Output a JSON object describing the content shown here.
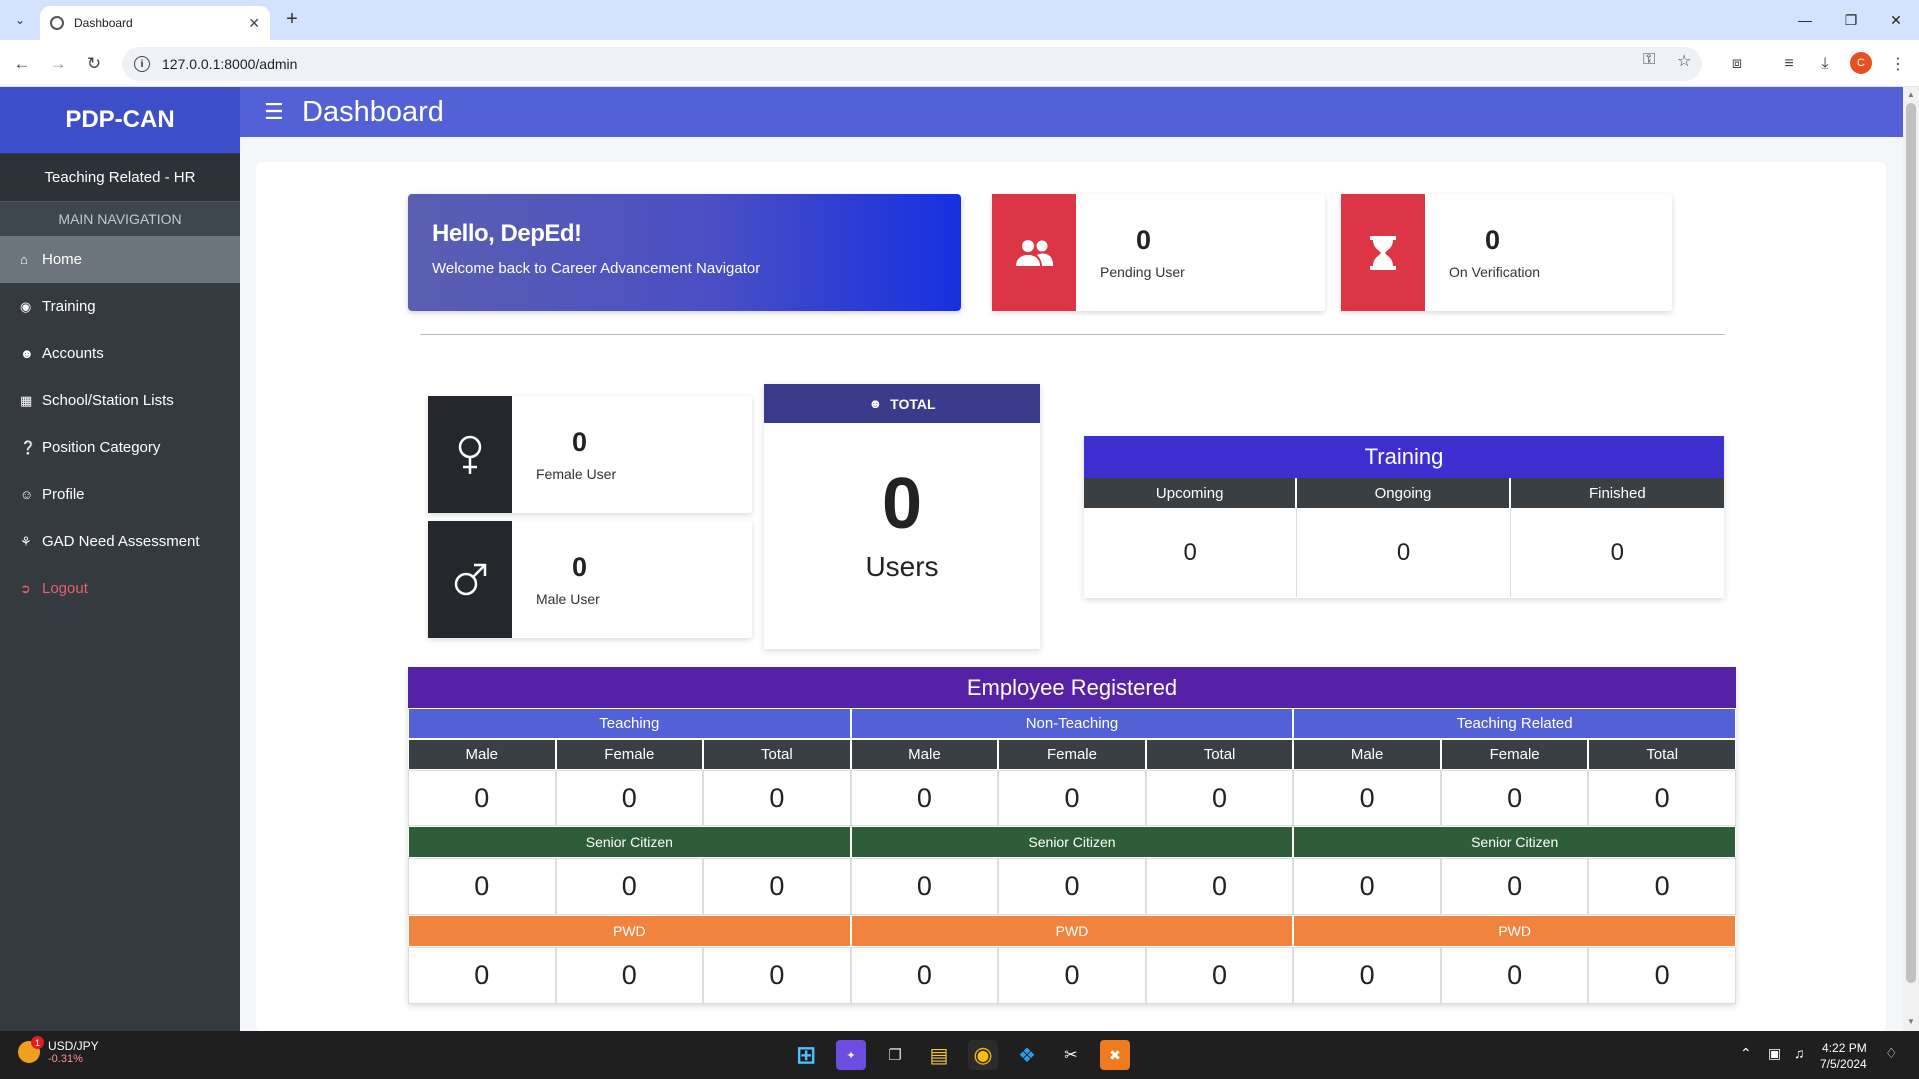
{
  "browser": {
    "tab_title": "Dashboard",
    "url": "127.0.0.1:8000/admin",
    "profile_initial": "C"
  },
  "sidebar": {
    "brand": "PDP-CAN",
    "role": "Teaching Related - HR",
    "nav_header": "MAIN NAVIGATION",
    "items": [
      {
        "label": "Home",
        "icon": "home-icon"
      },
      {
        "label": "Training",
        "icon": "training-icon"
      },
      {
        "label": "Accounts",
        "icon": "users-icon"
      },
      {
        "label": "School/Station Lists",
        "icon": "building-icon"
      },
      {
        "label": "Position Category",
        "icon": "question-icon"
      },
      {
        "label": "Profile",
        "icon": "user-circle-icon"
      },
      {
        "label": "GAD Need Assessment",
        "icon": "gad-icon"
      },
      {
        "label": "Logout",
        "icon": "logout-icon"
      }
    ]
  },
  "header": {
    "title": "Dashboard"
  },
  "greeting": {
    "title": "Hello, DepEd!",
    "subtitle": "Welcome back to Career Advancement Navigator"
  },
  "stats": {
    "pending": {
      "value": "0",
      "label": "Pending User"
    },
    "verification": {
      "value": "0",
      "label": "On Verification"
    },
    "female": {
      "value": "0",
      "label": "Female User"
    },
    "male": {
      "value": "0",
      "label": "Male User"
    }
  },
  "total": {
    "header": "TOTAL",
    "value": "0",
    "label": "Users"
  },
  "training": {
    "title": "Training",
    "columns": [
      "Upcoming",
      "Ongoing",
      "Finished"
    ],
    "values": [
      "0",
      "0",
      "0"
    ]
  },
  "employee": {
    "title": "Employee Registered",
    "groups": [
      "Teaching",
      "Non-Teaching",
      "Teaching Related"
    ],
    "subheaders": [
      "Male",
      "Female",
      "Total"
    ],
    "senior_label": "Senior Citizen",
    "pwd_label": "PWD",
    "rows": {
      "main": [
        "0",
        "0",
        "0",
        "0",
        "0",
        "0",
        "0",
        "0",
        "0"
      ],
      "senior": [
        "0",
        "0",
        "0",
        "0",
        "0",
        "0",
        "0",
        "0",
        "0"
      ],
      "pwd": [
        "0",
        "0",
        "0",
        "0",
        "0",
        "0",
        "0",
        "0",
        "0"
      ]
    }
  },
  "taskbar": {
    "ticker_symbol": "USD/JPY",
    "ticker_change": "-0.31%",
    "ticker_badge": "1",
    "time": "4:22 PM",
    "date": "7/5/2024"
  },
  "colors": {
    "brand": "#3d4fc8",
    "topbar": "#5361d6",
    "sidebar": "#343a40",
    "danger": "#dc3545",
    "training_header": "#3d2fd0",
    "employee_header": "#5522a5",
    "senior_band": "#2f5d3a",
    "pwd_band": "#f0843e"
  }
}
